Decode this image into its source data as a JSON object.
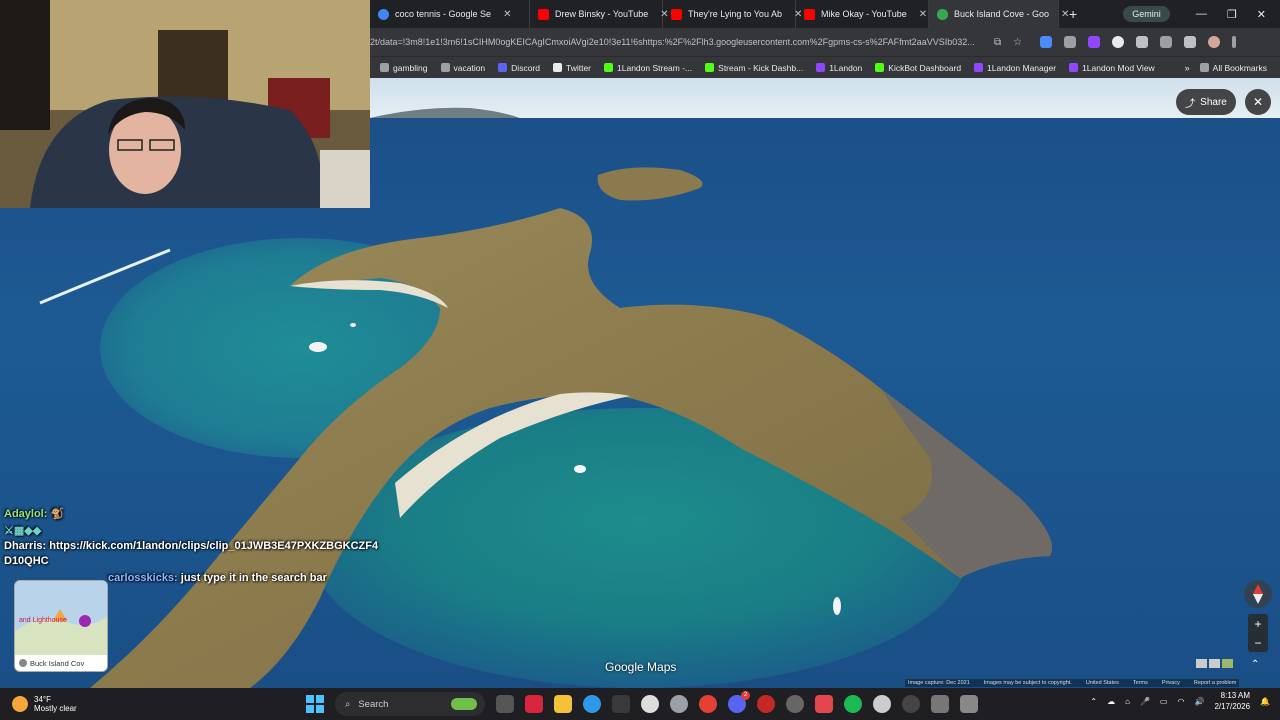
{
  "browser": {
    "tabs": [
      {
        "label": "coco tennis - Google Se",
        "favicon_color": "#4285f4",
        "active": false
      },
      {
        "label": "Drew Binsky - YouTube",
        "favicon_color": "#ff0000",
        "active": false
      },
      {
        "label": "They're Lying to You Ab",
        "favicon_color": "#ff0000",
        "active": false
      },
      {
        "label": "Mike Okay - YouTube",
        "favicon_color": "#ff0000",
        "active": false
      },
      {
        "label": "Buck Island Cove - Goo",
        "favicon_color": "#34a853",
        "active": true
      }
    ],
    "new_tab_label": "+",
    "gemini_label": "Gemini",
    "url": "2t/data=!3m8!1e1!3m6!1sCIHM0ogKEICAgICmxoiAVgi2e10!3e11!6shttps:%2F%2Flh3.googleusercontent.com%2Fgpms-cs-s%2FAFfmt2aaVVSIb032...",
    "bookmarks": [
      {
        "label": "gambling",
        "color": "#9aa0a6"
      },
      {
        "label": "vacation",
        "color": "#9aa0a6"
      },
      {
        "label": "Discord",
        "color": "#5865f2"
      },
      {
        "label": "Twitter",
        "color": "#e8eaed"
      },
      {
        "label": "1Landon Stream -...",
        "color": "#53fc18"
      },
      {
        "label": "Stream - Kick Dashb...",
        "color": "#53fc18"
      },
      {
        "label": "1Landon",
        "color": "#9146ff"
      },
      {
        "label": "KickBot Dashboard",
        "color": "#53fc18"
      },
      {
        "label": "1Landon Manager",
        "color": "#9146ff"
      },
      {
        "label": "1Landon Mod View",
        "color": "#9146ff"
      }
    ],
    "all_bookmarks_label": "All Bookmarks"
  },
  "map": {
    "share_label": "Share",
    "close_label": "✕",
    "brand": "Google Maps",
    "zoom_in": "+",
    "zoom_out": "−",
    "attribution": [
      "Image capture: Dec 2021",
      "Images may be subject to copyright.",
      "United States",
      "Terms",
      "Privacy",
      "Report a problem"
    ]
  },
  "chat": {
    "messages": [
      {
        "user": "Adaylol:",
        "text": ""
      },
      {
        "user": "Dharris:",
        "text": "https://kick.com/1landon/clips/clip_01JWB3E47PXKZBGKCZF4D10QHC"
      },
      {
        "user": "carlosskicks:",
        "text": "just type it in the search bar"
      }
    ],
    "minimap_label": "Buck Island Cov",
    "minimap_place": "and Lighthouse"
  },
  "taskbar": {
    "weather_temp": "34°F",
    "weather_desc": "Mostly clear",
    "search_label": "Search",
    "time": "8:13 AM",
    "date": "2/17/2026",
    "badge_count": "2"
  }
}
